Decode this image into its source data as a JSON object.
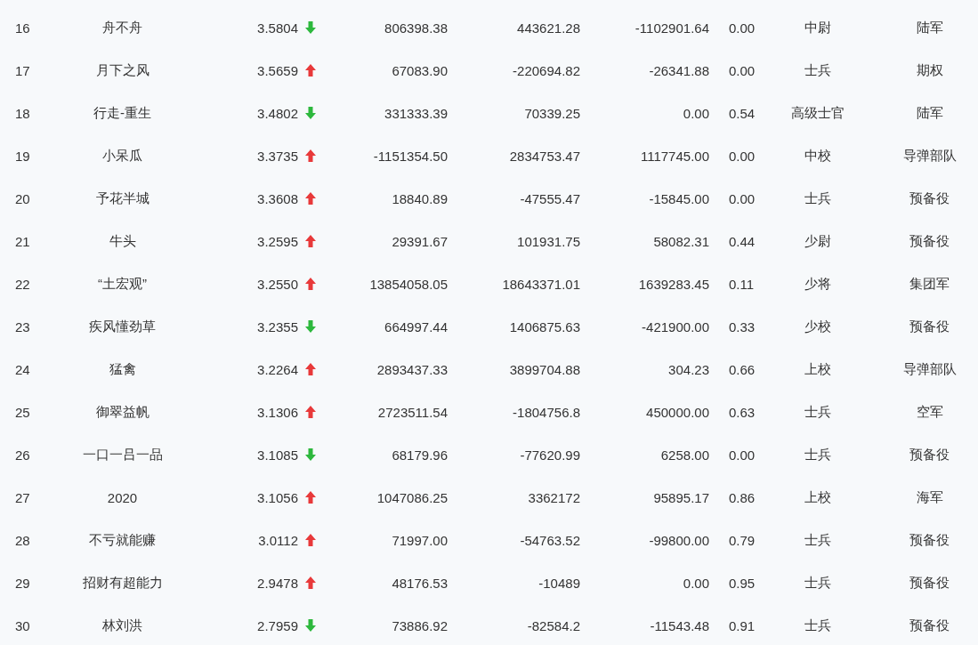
{
  "rows": [
    {
      "rank": "16",
      "name": "舟不舟",
      "score": "3.5804",
      "kind": "down",
      "column_4": "806398.38",
      "column_5": "443621.28",
      "column_6": "-1102901.64",
      "column_7": "0.00",
      "rank_title": "中尉",
      "branch": "陆军"
    },
    {
      "rank": "17",
      "name": "月下之风",
      "score": "3.5659",
      "kind": "up",
      "column_4": "67083.90",
      "column_5": "-220694.82",
      "column_6": "-26341.88",
      "column_7": "0.00",
      "rank_title": "士兵",
      "branch": "期权"
    },
    {
      "rank": "18",
      "name": "行走-重生",
      "score": "3.4802",
      "kind": "down",
      "column_4": "331333.39",
      "column_5": "70339.25",
      "column_6": "0.00",
      "column_7": "0.54",
      "rank_title": "高级士官",
      "branch": "陆军"
    },
    {
      "rank": "19",
      "name": "小呆瓜",
      "score": "3.3735",
      "kind": "up",
      "column_4": "-1151354.50",
      "column_5": "2834753.47",
      "column_6": "1117745.00",
      "column_7": "0.00",
      "rank_title": "中校",
      "branch": "导弹部队"
    },
    {
      "rank": "20",
      "name": "予花半城",
      "score": "3.3608",
      "kind": "up",
      "column_4": "18840.89",
      "column_5": "-47555.47",
      "column_6": "-15845.00",
      "column_7": "0.00",
      "rank_title": "士兵",
      "branch": "预备役"
    },
    {
      "rank": "21",
      "name": "牛头",
      "score": "3.2595",
      "kind": "up",
      "column_4": "29391.67",
      "column_5": "101931.75",
      "column_6": "58082.31",
      "column_7": "0.44",
      "rank_title": "少尉",
      "branch": "预备役"
    },
    {
      "rank": "22",
      "name": "“土宏观”",
      "score": "3.2550",
      "kind": "up",
      "column_4": "13854058.05",
      "column_5": "18643371.01",
      "column_6": "1639283.45",
      "column_7": "0.11",
      "rank_title": "少将",
      "branch": "集团军"
    },
    {
      "rank": "23",
      "name": "疾风懂劲草",
      "score": "3.2355",
      "kind": "down",
      "column_4": "664997.44",
      "column_5": "1406875.63",
      "column_6": "-421900.00",
      "column_7": "0.33",
      "rank_title": "少校",
      "branch": "预备役"
    },
    {
      "rank": "24",
      "name": "猛禽",
      "score": "3.2264",
      "kind": "up",
      "column_4": "2893437.33",
      "column_5": "3899704.88",
      "column_6": "304.23",
      "column_7": "0.66",
      "rank_title": "上校",
      "branch": "导弹部队"
    },
    {
      "rank": "25",
      "name": "御翠益帆",
      "score": "3.1306",
      "kind": "up",
      "column_4": "2723511.54",
      "column_5": "-1804756.8",
      "column_6": "450000.00",
      "column_7": "0.63",
      "rank_title": "士兵",
      "branch": "空军"
    },
    {
      "rank": "26",
      "name": "一口一吕一品",
      "score": "3.1085",
      "kind": "down",
      "column_4": "68179.96",
      "column_5": "-77620.99",
      "column_6": "6258.00",
      "column_7": "0.00",
      "rank_title": "士兵",
      "branch": "预备役"
    },
    {
      "rank": "27",
      "name": "2020",
      "score": "3.1056",
      "kind": "up",
      "column_4": "1047086.25",
      "column_5": "3362172",
      "column_6": "95895.17",
      "column_7": "0.86",
      "rank_title": "上校",
      "branch": "海军"
    },
    {
      "rank": "28",
      "name": "不亏就能赚",
      "score": "3.0112",
      "kind": "up",
      "column_4": "71997.00",
      "column_5": "-54763.52",
      "column_6": "-99800.00",
      "column_7": "0.79",
      "rank_title": "士兵",
      "branch": "预备役"
    },
    {
      "rank": "29",
      "name": "招财有超能力",
      "score": "2.9478",
      "kind": "up",
      "column_4": "48176.53",
      "column_5": "-10489",
      "column_6": "0.00",
      "column_7": "0.95",
      "rank_title": "士兵",
      "branch": "预备役"
    },
    {
      "rank": "30",
      "name": "林刘洪",
      "score": "2.7959",
      "kind": "down",
      "column_4": "73886.92",
      "column_5": "-82584.2",
      "column_6": "-11543.48",
      "column_7": "0.91",
      "rank_title": "士兵",
      "branch": "预备役"
    }
  ]
}
